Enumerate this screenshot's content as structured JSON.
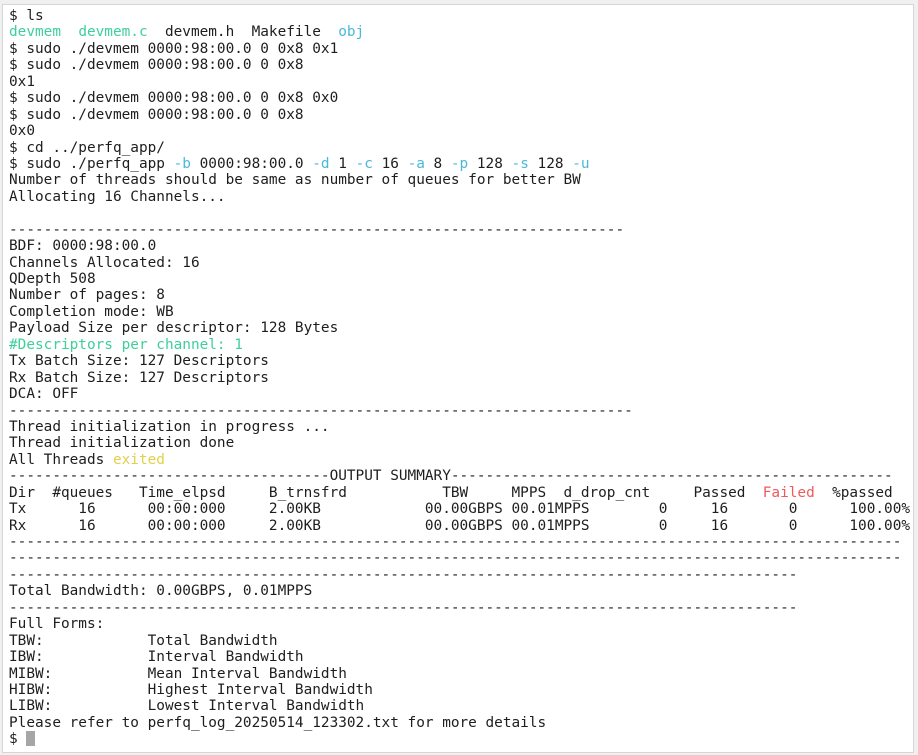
{
  "colors": {
    "text": "#1e1e1e",
    "exec": "#3ecf9a",
    "dir": "#4ab8dc",
    "flag": "#4ab8dc",
    "warn": "#e2d04a",
    "fail": "#ee5b5b",
    "info": "#3ecf9a"
  },
  "lines": [
    [
      {
        "t": "$ ls"
      }
    ],
    [
      {
        "t": "devmem",
        "c": "exec"
      },
      {
        "t": "  "
      },
      {
        "t": "devmem.c",
        "c": "exec"
      },
      {
        "t": "  devmem.h  Makefile  "
      },
      {
        "t": "obj",
        "c": "dir"
      }
    ],
    [
      {
        "t": "$ sudo ./devmem 0000:98:00.0 0 0x8 0x1"
      }
    ],
    [
      {
        "t": "$ sudo ./devmem 0000:98:00.0 0 0x8"
      }
    ],
    [
      {
        "t": "0x1"
      }
    ],
    [
      {
        "t": "$ sudo ./devmem 0000:98:00.0 0 0x8 0x0"
      }
    ],
    [
      {
        "t": "$ sudo ./devmem 0000:98:00.0 0 0x8"
      }
    ],
    [
      {
        "t": "0x0"
      }
    ],
    [
      {
        "t": "$ cd ../perfq_app/"
      }
    ],
    [
      {
        "t": "$ sudo ./perfq_app "
      },
      {
        "t": "-b",
        "c": "flag"
      },
      {
        "t": " 0000:98:00.0 "
      },
      {
        "t": "-d",
        "c": "flag"
      },
      {
        "t": " 1 "
      },
      {
        "t": "-c",
        "c": "flag"
      },
      {
        "t": " 16 "
      },
      {
        "t": "-a",
        "c": "flag"
      },
      {
        "t": " 8 "
      },
      {
        "t": "-p",
        "c": "flag"
      },
      {
        "t": " 128 "
      },
      {
        "t": "-s",
        "c": "flag"
      },
      {
        "t": " 128 "
      },
      {
        "t": "-u",
        "c": "flag"
      }
    ],
    [
      {
        "t": "Number of threads should be same as number of queues for better BW"
      }
    ],
    [
      {
        "t": "Allocating 16 Channels..."
      }
    ],
    [
      {
        "t": ""
      }
    ],
    [
      {
        "t": "-----------------------------------------------------------------------"
      }
    ],
    [
      {
        "t": "BDF: 0000:98:00.0"
      }
    ],
    [
      {
        "t": "Channels Allocated: 16"
      }
    ],
    [
      {
        "t": "QDepth 508"
      }
    ],
    [
      {
        "t": "Number of pages: 8"
      }
    ],
    [
      {
        "t": "Completion mode: WB"
      }
    ],
    [
      {
        "t": "Payload Size per descriptor: 128 Bytes"
      }
    ],
    [
      {
        "t": "#Descriptors per channel: 1",
        "c": "info"
      }
    ],
    [
      {
        "t": "Tx Batch Size: 127 Descriptors"
      }
    ],
    [
      {
        "t": "Rx Batch Size: 127 Descriptors"
      }
    ],
    [
      {
        "t": "DCA: OFF"
      }
    ],
    [
      {
        "t": "------------------------------------------------------------------------"
      }
    ],
    [
      {
        "t": "Thread initialization in progress ..."
      }
    ],
    [
      {
        "t": "Thread initialization done"
      }
    ],
    [
      {
        "t": "All Threads "
      },
      {
        "t": "exited",
        "c": "warn"
      }
    ],
    [
      {
        "t": "-------------------------------------OUTPUT SUMMARY---------------------------------------------------"
      }
    ],
    [
      {
        "t": "Dir  #queues   Time_elpsd     B_trnsfrd           TBW     MPPS  d_drop_cnt     Passed  "
      },
      {
        "t": "Failed",
        "c": "fail"
      },
      {
        "t": "  %passed"
      }
    ],
    [
      {
        "t": "Tx      16      00:00:000     2.00KB            00.00GBPS 00.01MPPS        0     16       0      100.00%"
      }
    ],
    [
      {
        "t": "Rx      16      00:00:000     2.00KB            00.00GBPS 00.01MPPS        0     16       0      100.00%"
      }
    ],
    [
      {
        "t": "-------------------------------------------------------------------------------------------------------"
      }
    ],
    [
      {
        "t": "-------------------------------------------------------------------------------------------------------"
      }
    ],
    [
      {
        "t": "-------------------------------------------------------------------------------------------"
      }
    ],
    [
      {
        "t": "Total Bandwidth: 0.00GBPS, 0.01MPPS"
      }
    ],
    [
      {
        "t": "-------------------------------------------------------------------------------------------"
      }
    ],
    [
      {
        "t": "Full Forms:"
      }
    ],
    [
      {
        "t": "TBW:            Total Bandwidth"
      }
    ],
    [
      {
        "t": "IBW:            Interval Bandwidth"
      }
    ],
    [
      {
        "t": "MIBW:           Mean Interval Bandwidth"
      }
    ],
    [
      {
        "t": "HIBW:           Highest Interval Bandwidth"
      }
    ],
    [
      {
        "t": "LIBW:           Lowest Interval Bandwidth"
      }
    ],
    [
      {
        "t": "Please refer to perfq_log_20250514_123302.txt for more details"
      }
    ],
    [
      {
        "t": "$ "
      }
    ]
  ]
}
